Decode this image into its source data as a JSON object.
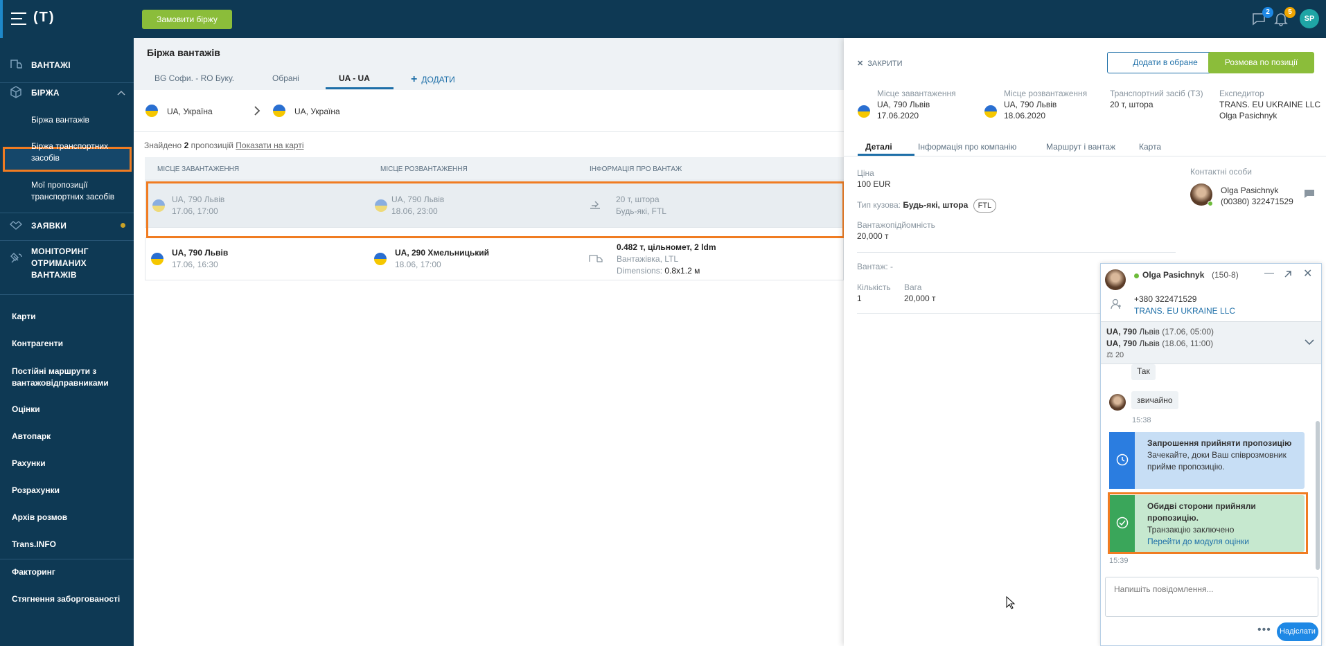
{
  "topbar": {
    "logo": "(T)",
    "order_button": "Замовити біржу",
    "messages_count": "2",
    "notifications_count": "5",
    "avatar_initials": "SP"
  },
  "sidebar": {
    "cargo": "ВАНТАЖІ",
    "exchange": "БІРЖА",
    "exchange_items": [
      "Біржа вантажів",
      "Біржа транспортних засобів",
      "Мої пропозиції транспортних засобів"
    ],
    "orders": "ЗАЯВКИ",
    "monitoring": "МОНІТОРИНГ ОТРИМАНИХ ВАНТАЖІВ",
    "links": [
      "Карти",
      "Контрагенти",
      "Постійні маршрути з вантажовідправниками",
      "Оцінки",
      "Автопарк",
      "Рахунки",
      "Розрахунки",
      "Архів розмов",
      "Trans.INFO"
    ],
    "links2": [
      "Факторинг",
      "Стягнення заборгованості"
    ]
  },
  "main": {
    "title": "Біржа вантажів",
    "tabs": [
      "BG Софи. - RO Буку.",
      "Обрані",
      "UA - UA",
      "ДОДАТИ"
    ],
    "route_from": "UA, Україна",
    "route_to": "UA, Україна",
    "found_prefix": "Знайдено",
    "found_count": "2",
    "found_suffix": "пропозицій",
    "show_on_map": "Показати на карті",
    "columns": [
      "МІСЦЕ ЗАВАНТАЖЕННЯ",
      "МІСЦЕ РОЗВАНТАЖЕННЯ",
      "ІНФОРМАЦІЯ ПРО ВАНТАЖ"
    ],
    "rows": [
      {
        "from": "UA, 790 Львів",
        "from_date": "17.06, 17:00",
        "to": "UA, 790 Львів",
        "to_date": "18.06, 23:00",
        "info1": "20 т, штора",
        "info2": "Будь-які, FTL",
        "info3": ""
      },
      {
        "from": "UA, 790 Львів",
        "from_date": "17.06, 16:30",
        "to": "UA, 290 Хмельницький",
        "to_date": "18.06, 17:00",
        "info1": "0.482 т, цільномет, 2 ldm",
        "info2": "Вантажівка, LTL",
        "info3_label": "Dimensions:",
        "info3": "0.8x1.2 м"
      }
    ]
  },
  "panel": {
    "close": "ЗАКРИТИ",
    "add_fav": "Додати в обране",
    "talk": "Розмова по позиції",
    "load_label": "Місце завантаження",
    "load_place": "UA, 790 Львів",
    "load_date": "17.06.2020",
    "unload_label": "Місце розвантаження",
    "unload_place": "UA, 790 Львів",
    "unload_date": "18.06.2020",
    "vehicle_label": "Транспортний засіб (ТЗ)",
    "vehicle": "20 т, штора",
    "forwarder_label": "Експедитор",
    "forwarder_company": "TRANS. EU UKRAINE LLC",
    "forwarder_name": "Olga Pasichnyk",
    "tabs": [
      "Деталі",
      "Інформація про компанію",
      "Маршрут і вантаж",
      "Карта"
    ],
    "price_label": "Ціна",
    "price": "100 EUR",
    "body_label": "Тип кузова:",
    "body": "Будь-які, штора",
    "ftl": "FTL",
    "capacity_label": "Вантажопідйомність",
    "capacity": "20,000 т",
    "cargo_label": "Вантаж: -",
    "qty_label": "Кількість",
    "qty": "1",
    "weight_label": "Вага",
    "weight": "20,000 т",
    "contacts_label": "Контактні особи",
    "contact_name": "Olga Pasichnyk",
    "contact_phone": "(00380) 322471529"
  },
  "chat": {
    "name": "Olga Pasichnyk",
    "id": "(150-8)",
    "phone": "+380 322471529",
    "company": "TRANS. EU UKRAINE LLC",
    "route1_bold": "UA, 790",
    "route1_city": "Львів",
    "route1_time": "(17.06, 05:00)",
    "route2_bold": "UA, 790",
    "route2_city": "Львів",
    "route2_time": "(18.06, 11:00)",
    "route_weight": "20",
    "msg_yes": "Так",
    "msg_sure": "звичайно",
    "msg_time": "15:38",
    "invite_title": "Запрошення прийняти пропозицію",
    "invite_text": "Зачекайте, доки Ваш співрозмовник прийме пропозицію.",
    "accepted_title": "Обидві сторони прийняли пропозицію.",
    "accepted_text": "Транзакцію заключено",
    "accepted_link": "Перейти до модуля оцінки",
    "accepted_time": "15:39",
    "input_placeholder": "Напишіть повідомлення...",
    "send": "Надіслати"
  },
  "colors": {
    "navy": "#0e3954",
    "green": "#8bbd3a",
    "highlight": "#f07c22",
    "blue": "#1e6fa8"
  }
}
